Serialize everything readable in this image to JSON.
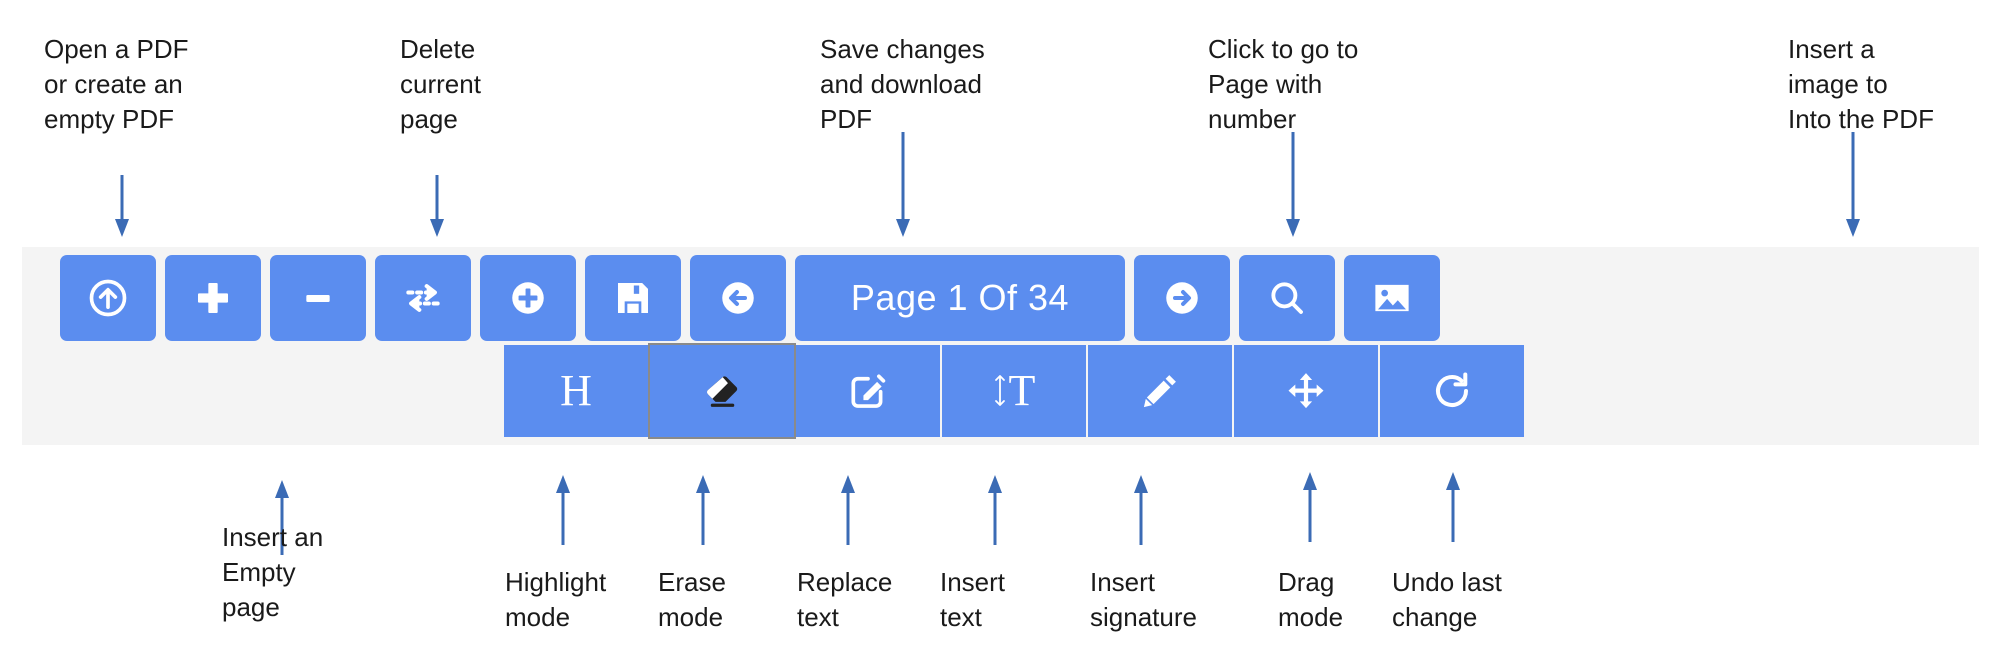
{
  "app": {
    "title": "PDF Editor Toolbar",
    "accent_color": "#5b8def",
    "toolbar_background": "#f4f4f4",
    "icon_color": "#ffffff",
    "annotation_color": "#1a1a1a",
    "arrow_color": "#3b6bb5",
    "active_outline_color": "#8a8a8a"
  },
  "toolbar": {
    "row1": [
      {
        "name": "open-pdf",
        "icon": "upload-circle-icon",
        "label": ""
      },
      {
        "name": "insert-empty-page",
        "icon": "plus-icon",
        "label": ""
      },
      {
        "name": "delete-page",
        "icon": "minus-icon",
        "label": ""
      },
      {
        "name": "swap-pages",
        "icon": "exchange-arrows-icon",
        "label": ""
      },
      {
        "name": "zoom-in",
        "icon": "plus-circle-icon",
        "label": ""
      },
      {
        "name": "save-download",
        "icon": "floppy-save-icon",
        "label": ""
      },
      {
        "name": "previous-page",
        "icon": "arrow-left-circle-icon",
        "label": ""
      },
      {
        "name": "page-indicator",
        "icon": "",
        "label": "Page 1 Of 34"
      },
      {
        "name": "next-page",
        "icon": "arrow-right-circle-icon",
        "label": ""
      },
      {
        "name": "search",
        "icon": "magnifier-icon",
        "label": ""
      },
      {
        "name": "insert-image",
        "icon": "image-icon",
        "label": ""
      }
    ],
    "row2": [
      {
        "name": "highlight-mode",
        "icon": "letter-h-icon",
        "label": "H",
        "active": false
      },
      {
        "name": "erase-mode",
        "icon": "eraser-icon",
        "label": "",
        "active": true
      },
      {
        "name": "replace-text",
        "icon": "edit-square-icon",
        "label": "",
        "active": false
      },
      {
        "name": "insert-text",
        "icon": "insert-text-icon",
        "label": "T",
        "active": false
      },
      {
        "name": "insert-signature",
        "icon": "pencil-icon",
        "label": "",
        "active": false
      },
      {
        "name": "drag-mode",
        "icon": "move-arrows-icon",
        "label": "",
        "active": false
      },
      {
        "name": "undo-change",
        "icon": "refresh-undo-icon",
        "label": "",
        "active": false
      }
    ]
  },
  "annotations": {
    "top": [
      {
        "name": "annotation-open-pdf",
        "text": "Open a PDF\nor create an\nempty PDF"
      },
      {
        "name": "annotation-delete-page",
        "text": "Delete\ncurrent\npage"
      },
      {
        "name": "annotation-save",
        "text": "Save changes\nand download\nPDF"
      },
      {
        "name": "annotation-page-number",
        "text": "Click to go to\nPage with\nnumber"
      },
      {
        "name": "annotation-insert-image",
        "text": "Insert a\nimage to\nInto the PDF"
      }
    ],
    "bottom": [
      {
        "name": "annotation-insert-empty-page",
        "text": "Insert an\nEmpty\npage"
      },
      {
        "name": "annotation-highlight-mode",
        "text": "Highlight\nmode"
      },
      {
        "name": "annotation-erase-mode",
        "text": "Erase\nmode"
      },
      {
        "name": "annotation-replace-text",
        "text": "Replace\ntext"
      },
      {
        "name": "annotation-insert-text",
        "text": "Insert\ntext"
      },
      {
        "name": "annotation-insert-signature",
        "text": "Insert\nsignature"
      },
      {
        "name": "annotation-drag-mode",
        "text": "Drag\nmode"
      },
      {
        "name": "annotation-undo-change",
        "text": "Undo last\nchange"
      }
    ]
  }
}
